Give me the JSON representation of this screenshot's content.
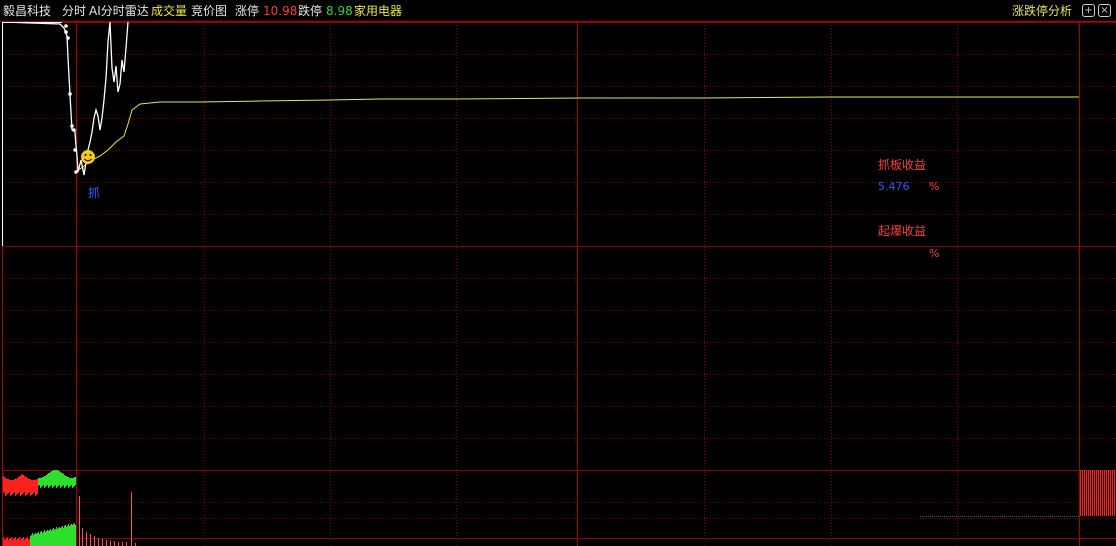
{
  "header": {
    "stock_name": "毅昌科技",
    "tab_intraday": "分时",
    "tab_ai_radar": "AI分时雷达",
    "tab_volume": "成交量",
    "tab_auction": "竞价图",
    "limit_up_label": "涨停",
    "limit_up_value": "10.98",
    "limit_down_label": "跌停",
    "limit_down_value": "8.98",
    "sector": "家用电器",
    "analysis_label": "涨跌停分析",
    "analysis_icon": "plus-circle-icon",
    "close_icon": "close-square-icon"
  },
  "chart": {
    "buy_marker": "抓",
    "smiley_icon": "smiley-icon",
    "grab_profit_label": "抓板收益",
    "grab_profit_value": "5.476",
    "grab_profit_unit": "%",
    "burst_profit_label": "起爆收益",
    "burst_profit_unit": "%"
  },
  "colors": {
    "grid": "#8b0000",
    "price_line": "#ffffff",
    "avg_line": "#e8e84a",
    "volume_up": "#ff2020",
    "volume_down": "#2ee02e",
    "limit_up": "#ff3b3b",
    "limit_down": "#39d239"
  }
}
